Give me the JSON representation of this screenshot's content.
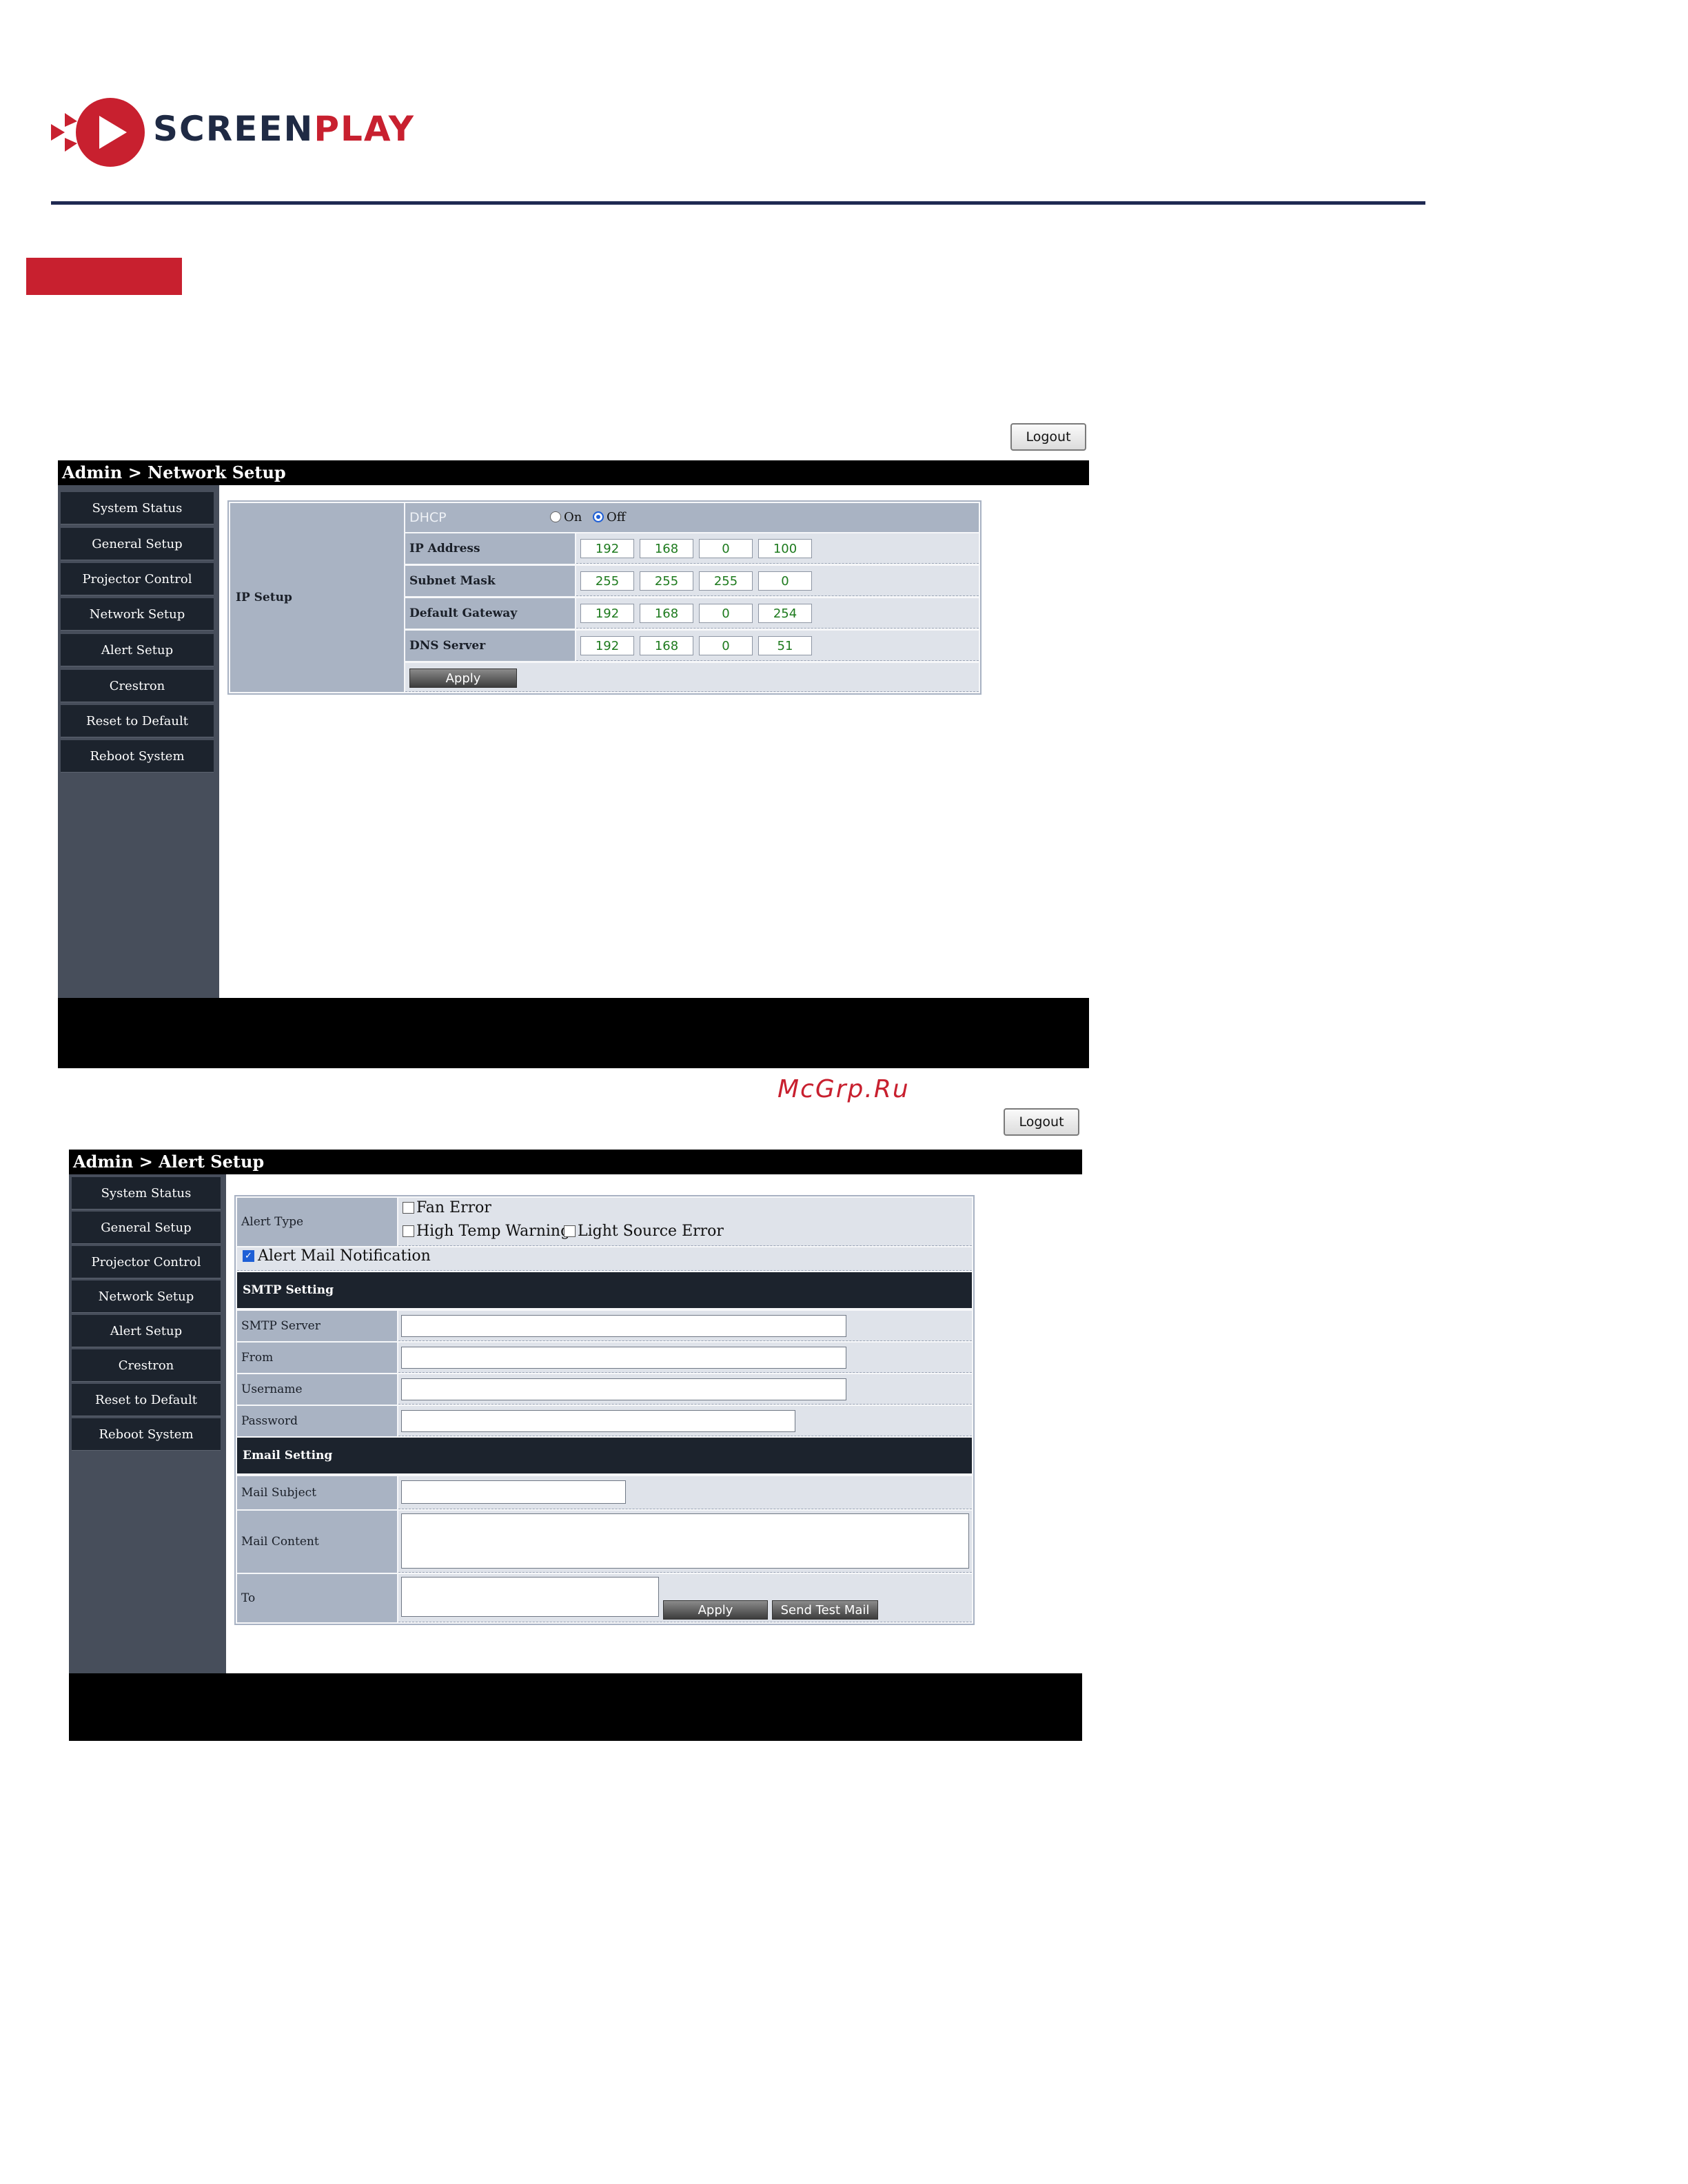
{
  "brand": {
    "name_part1": "SCREEN",
    "name_part2": "PLAY",
    "accent": "#c8202f",
    "dark": "#1f2a44"
  },
  "watermark": "McGrp.Ru",
  "network_panel": {
    "logout_label": "Logout",
    "title": "Admin > Network Setup",
    "nav": [
      "System Status",
      "General Setup",
      "Projector Control",
      "Network Setup",
      "Alert Setup",
      "Crestron",
      "Reset to Default",
      "Reboot System"
    ],
    "section_label": "IP Setup",
    "dhcp": {
      "label": "DHCP",
      "on_label": "On",
      "off_label": "Off",
      "selected": "Off"
    },
    "rows": [
      {
        "label": "IP Address",
        "octets": [
          "192",
          "168",
          "0",
          "100"
        ]
      },
      {
        "label": "Subnet Mask",
        "octets": [
          "255",
          "255",
          "255",
          "0"
        ]
      },
      {
        "label": "Default Gateway",
        "octets": [
          "192",
          "168",
          "0",
          "254"
        ]
      },
      {
        "label": "DNS Server",
        "octets": [
          "192",
          "168",
          "0",
          "51"
        ]
      }
    ],
    "apply_label": "Apply"
  },
  "alert_panel": {
    "logout_label": "Logout",
    "title": "Admin > Alert Setup",
    "nav": [
      "System Status",
      "General Setup",
      "Projector Control",
      "Network Setup",
      "Alert Setup",
      "Crestron",
      "Reset to Default",
      "Reboot System"
    ],
    "alert_type_label": "Alert Type",
    "alert_types": [
      {
        "label": "Fan Error",
        "checked": false
      },
      {
        "label": "High Temp Warning",
        "checked": false
      },
      {
        "label": "Light Source Error",
        "checked": false
      }
    ],
    "mail_notification": {
      "label": "Alert Mail Notification",
      "checked": true
    },
    "smtp_section": "SMTP Setting",
    "smtp_fields": [
      {
        "label": "SMTP Server",
        "value": ""
      },
      {
        "label": "From",
        "value": ""
      },
      {
        "label": "Username",
        "value": ""
      },
      {
        "label": "Password",
        "value": ""
      }
    ],
    "email_section": "Email Setting",
    "mail_subject_label": "Mail Subject",
    "mail_content_label": "Mail Content",
    "to_label": "To",
    "apply_label": "Apply",
    "send_test_label": "Send Test Mail"
  }
}
